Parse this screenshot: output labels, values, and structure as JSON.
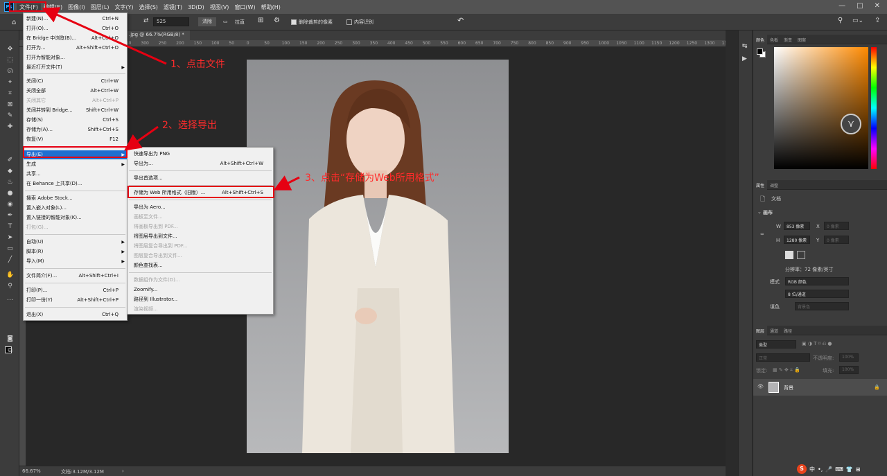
{
  "menubar": {
    "logo": "Ps",
    "items": [
      "文件(F)",
      "编辑(E)",
      "图像(I)",
      "图层(L)",
      "文字(Y)",
      "选择(S)",
      "滤镜(T)",
      "3D(D)",
      "视图(V)",
      "窗口(W)",
      "帮助(H)"
    ]
  },
  "window_controls": {
    "minimize": "—",
    "maximize": "□",
    "close": "✕"
  },
  "options_bar": {
    "field_value": "525",
    "clear_button": "清除",
    "straighten_label": "拉直",
    "delete_cropped_label": "删除裁剪的像素",
    "content_aware_label": "内容识别"
  },
  "document_tab": ".jpg @ 66.7%(RGB/8) *",
  "ruler_ticks": [
    "350",
    "300",
    "250",
    "200",
    "150",
    "100",
    "50",
    "0",
    "50",
    "100",
    "150",
    "200",
    "250",
    "300",
    "350",
    "400",
    "450",
    "500",
    "550",
    "600",
    "650",
    "700",
    "750",
    "800",
    "850",
    "900",
    "950",
    "1000",
    "1050",
    "1100",
    "1150",
    "1200",
    "1250",
    "1300",
    "1350",
    "1400",
    "1450",
    "1500"
  ],
  "status": {
    "zoom": "66.67%",
    "doc": "文档:3.12M/3.12M"
  },
  "file_menu": [
    {
      "label": "新建(N)...",
      "shortcut": "Ctrl+N"
    },
    {
      "label": "打开(O)...",
      "shortcut": "Ctrl+O"
    },
    {
      "label": "在 Bridge 中浏览(B)...",
      "shortcut": "Alt+Ctrl+O"
    },
    {
      "label": "打开为...",
      "shortcut": "Alt+Shift+Ctrl+O"
    },
    {
      "label": "打开为智能对象...",
      "shortcut": ""
    },
    {
      "label": "最近打开文件(T)",
      "shortcut": ""
    },
    {
      "label": "关闭(C)",
      "shortcut": "Ctrl+W"
    },
    {
      "label": "关闭全部",
      "shortcut": "Alt+Ctrl+W"
    },
    {
      "label": "关闭其它",
      "shortcut": "Alt+Ctrl+P"
    },
    {
      "label": "关闭并转到 Bridge...",
      "shortcut": "Shift+Ctrl+W"
    },
    {
      "label": "存储(S)",
      "shortcut": "Ctrl+S"
    },
    {
      "label": "存储为(A)...",
      "shortcut": "Shift+Ctrl+S"
    },
    {
      "label": "恢复(V)",
      "shortcut": "F12"
    },
    {
      "label": "导出(E)",
      "shortcut": ""
    },
    {
      "label": "生成",
      "shortcut": ""
    },
    {
      "label": "共享...",
      "shortcut": ""
    },
    {
      "label": "在 Behance 上共享(D)...",
      "shortcut": ""
    },
    {
      "label": "搜索 Adobe Stock...",
      "shortcut": ""
    },
    {
      "label": "置入嵌入对象(L)...",
      "shortcut": ""
    },
    {
      "label": "置入链接的智能对象(K)...",
      "shortcut": ""
    },
    {
      "label": "打包(G)...",
      "shortcut": ""
    },
    {
      "label": "自动(U)",
      "shortcut": ""
    },
    {
      "label": "脚本(R)",
      "shortcut": ""
    },
    {
      "label": "导入(M)",
      "shortcut": ""
    },
    {
      "label": "文件简介(F)...",
      "shortcut": "Alt+Shift+Ctrl+I"
    },
    {
      "label": "打印(P)...",
      "shortcut": "Ctrl+P"
    },
    {
      "label": "打印一份(Y)",
      "shortcut": "Alt+Shift+Ctrl+P"
    },
    {
      "label": "退出(X)",
      "shortcut": "Ctrl+Q"
    }
  ],
  "export_menu": [
    {
      "label": "快速导出为 PNG",
      "shortcut": ""
    },
    {
      "label": "导出为...",
      "shortcut": "Alt+Shift+Ctrl+W"
    },
    {
      "label": "导出首选项...",
      "shortcut": ""
    },
    {
      "label": "存储为 Web 所用格式（旧版）...",
      "shortcut": "Alt+Shift+Ctrl+S"
    },
    {
      "label": "导出为 Aero...",
      "shortcut": ""
    },
    {
      "label": "画板至文件...",
      "shortcut": ""
    },
    {
      "label": "将画板导出到 PDF...",
      "shortcut": ""
    },
    {
      "label": "将图层导出到文件...",
      "shortcut": ""
    },
    {
      "label": "将图层复合导出到 PDF...",
      "shortcut": ""
    },
    {
      "label": "图层复合导出到文件...",
      "shortcut": ""
    },
    {
      "label": "颜色查找表...",
      "shortcut": ""
    },
    {
      "label": "数据组作为文件(D)...",
      "shortcut": ""
    },
    {
      "label": "Zoomify...",
      "shortcut": ""
    },
    {
      "label": "路径到 Illustrator...",
      "shortcut": ""
    },
    {
      "label": "渲染视频...",
      "shortcut": ""
    }
  ],
  "annotations": {
    "step1": "1、点击文件",
    "step2": "2、选择导出",
    "step3": "3、点击“存储为Web所用格式”",
    "color": "#e60012"
  },
  "color_panel": {
    "tabs": [
      "颜色",
      "色板",
      "渐变",
      "图案"
    ]
  },
  "properties_panel": {
    "tabs": [
      "属性",
      "调整"
    ],
    "doc_label": "文档",
    "section": "画布",
    "w_label": "W",
    "w_value": "853 像素",
    "x_label": "X",
    "x_value": "0 像素",
    "h_label": "H",
    "h_value": "1280 像素",
    "y_label": "Y",
    "y_value": "0 像素",
    "resolution": "分辨率：72 像素/英寸",
    "mode_label": "模式",
    "mode_value": "RGB 颜色",
    "bit_value": "8 位/通道",
    "fill_label": "填色",
    "fill_value": "背景色"
  },
  "layers_panel": {
    "tabs": [
      "图层",
      "通道",
      "路径"
    ],
    "search": "类型",
    "blend": "正常",
    "opacity_label": "不透明度:",
    "opacity_value": "100%",
    "lock_label": "锁定:",
    "fill_label": "填充:",
    "fill_value": "100%",
    "layer_name": "背景"
  },
  "ime": {
    "lang": "中",
    "punct": "•,"
  }
}
